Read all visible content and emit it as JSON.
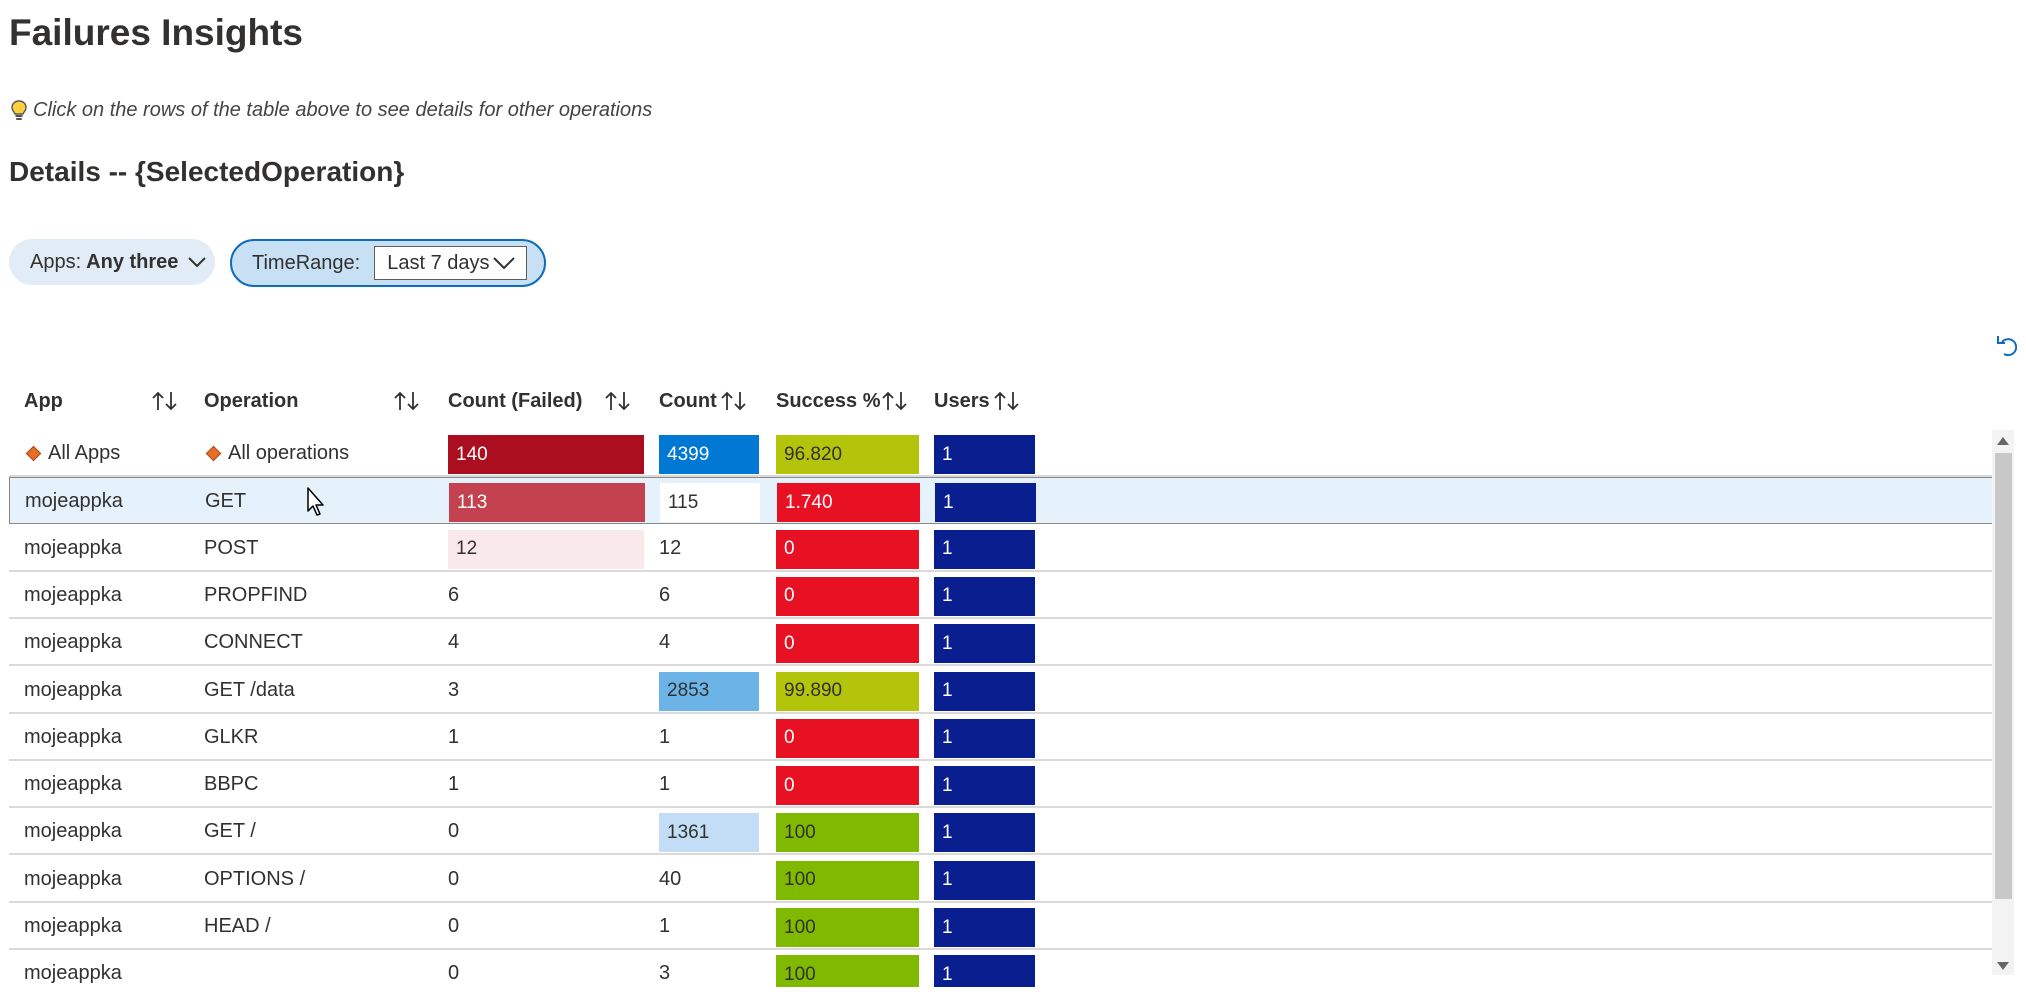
{
  "page": {
    "title": "Failures Insights",
    "tip": "Click on the rows of the table above to see details for other operations",
    "details_title": "Details -- {SelectedOperation}"
  },
  "filters": {
    "apps": {
      "label": "Apps:",
      "value": "Any three"
    },
    "timerange": {
      "label": "TimeRange:",
      "value": "Last 7 days"
    }
  },
  "table": {
    "columns": [
      "App",
      "Operation",
      "Count (Failed)",
      "Count",
      "Success %",
      "Users"
    ],
    "selected_row_index": 1,
    "rows": [
      {
        "app": "All Apps",
        "op": "All operations",
        "failed": "140",
        "count": "4399",
        "success": "96.820",
        "users": "1",
        "summary": true
      },
      {
        "app": "mojeappka",
        "op": "GET",
        "failed": "113",
        "count": "115",
        "success": "1.740",
        "users": "1"
      },
      {
        "app": "mojeappka",
        "op": "POST",
        "failed": "12",
        "count": "12",
        "success": "0",
        "users": "1"
      },
      {
        "app": "mojeappka",
        "op": "PROPFIND",
        "failed": "6",
        "count": "6",
        "success": "0",
        "users": "1"
      },
      {
        "app": "mojeappka",
        "op": "CONNECT",
        "failed": "4",
        "count": "4",
        "success": "0",
        "users": "1"
      },
      {
        "app": "mojeappka",
        "op": "GET /data",
        "failed": "3",
        "count": "2853",
        "success": "99.890",
        "users": "1"
      },
      {
        "app": "mojeappka",
        "op": "GLKR",
        "failed": "1",
        "count": "1",
        "success": "0",
        "users": "1"
      },
      {
        "app": "mojeappka",
        "op": "BBPC",
        "failed": "1",
        "count": "1",
        "success": "0",
        "users": "1"
      },
      {
        "app": "mojeappka",
        "op": "GET /",
        "failed": "0",
        "count": "1361",
        "success": "100",
        "users": "1"
      },
      {
        "app": "mojeappka",
        "op": "OPTIONS /",
        "failed": "0",
        "count": "40",
        "success": "100",
        "users": "1"
      },
      {
        "app": "mojeappka",
        "op": "HEAD /",
        "failed": "0",
        "count": "1",
        "success": "100",
        "users": "1"
      },
      {
        "app": "mojeappka",
        "op": "",
        "failed": "0",
        "count": "3",
        "success": "100",
        "users": "1"
      }
    ]
  },
  "colors": {
    "failed_strong": "#ab0f1f",
    "failed_mid": "#c4424f",
    "failed_light": "#f9e9eb",
    "count_strong": "#0078d4",
    "count_mid": "#6cb3e8",
    "count_light": "#c2ddf5",
    "success_yellowgreen": "#b4c40a",
    "success_green": "#7fba00",
    "success_red": "#e81123",
    "users_navy": "#0a1f8f",
    "accent": "#0f6cbd"
  },
  "icons": {
    "tip": "lightbulb-icon",
    "dropdown": "chevron-down-icon",
    "sort": "sort-arrows-icon",
    "refresh": "undo-icon",
    "summary": "diamond-icon"
  }
}
